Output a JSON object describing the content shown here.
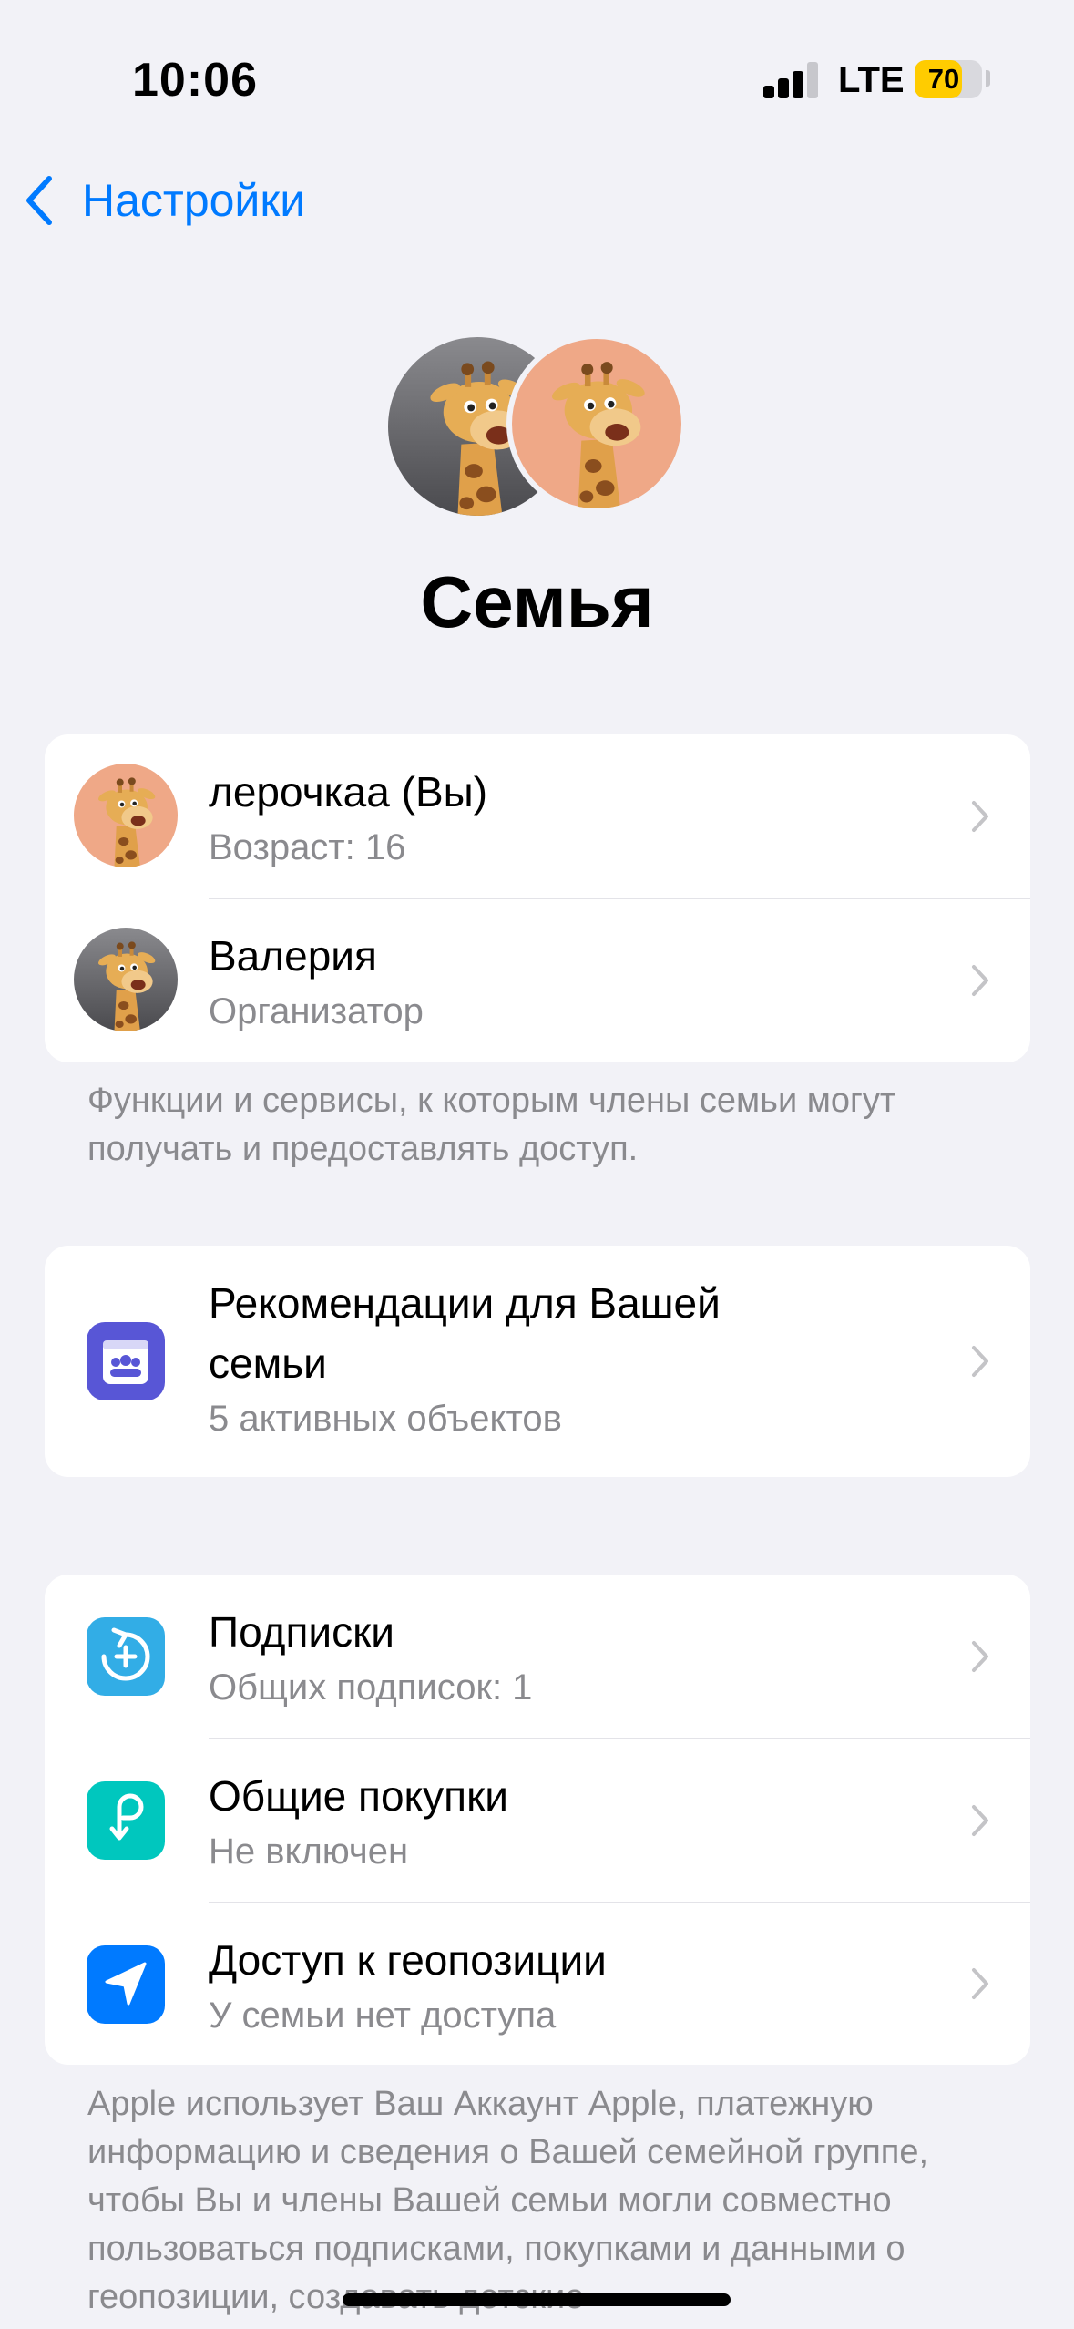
{
  "status": {
    "time": "10:06",
    "network": "LTE",
    "battery": "70",
    "battery_level": 0.7
  },
  "nav": {
    "back_label": "Настройки"
  },
  "header": {
    "title": "Семья"
  },
  "members": [
    {
      "name": "лерочкаа (Вы)",
      "detail": "Возраст: 16",
      "avatar": "giraffe-peach"
    },
    {
      "name": "Валерия",
      "detail": "Организатор",
      "avatar": "giraffe-gray"
    }
  ],
  "members_footnote": "Функции и сервисы, к которым члены семьи могут получать и предоставлять доступ.",
  "recommendations": {
    "title_line1": "Рекомендации для Вашей",
    "title_line2": "семьи",
    "detail": "5 активных объектов",
    "icon": "family-checklist-icon",
    "color": "#5856d6"
  },
  "services": [
    {
      "title": "Подписки",
      "detail": "Общих подписок: 1",
      "icon": "subscriptions-icon",
      "color": "#32ade6"
    },
    {
      "title": "Общие покупки",
      "detail": "Не включен",
      "icon": "purchase-sharing-icon",
      "color": "#00c7be"
    },
    {
      "title": "Доступ к геопозиции",
      "detail": "У семьи нет доступа",
      "icon": "location-arrow-icon",
      "color": "#007aff"
    }
  ],
  "services_footnote": "Apple использует Ваш Аккаунт Apple, платежную информацию и сведения о Вашей семейной группе, чтобы Вы и члены Вашей семьи могли совместно пользоваться подписками, покупками и данными о геопозиции, создавать детские"
}
